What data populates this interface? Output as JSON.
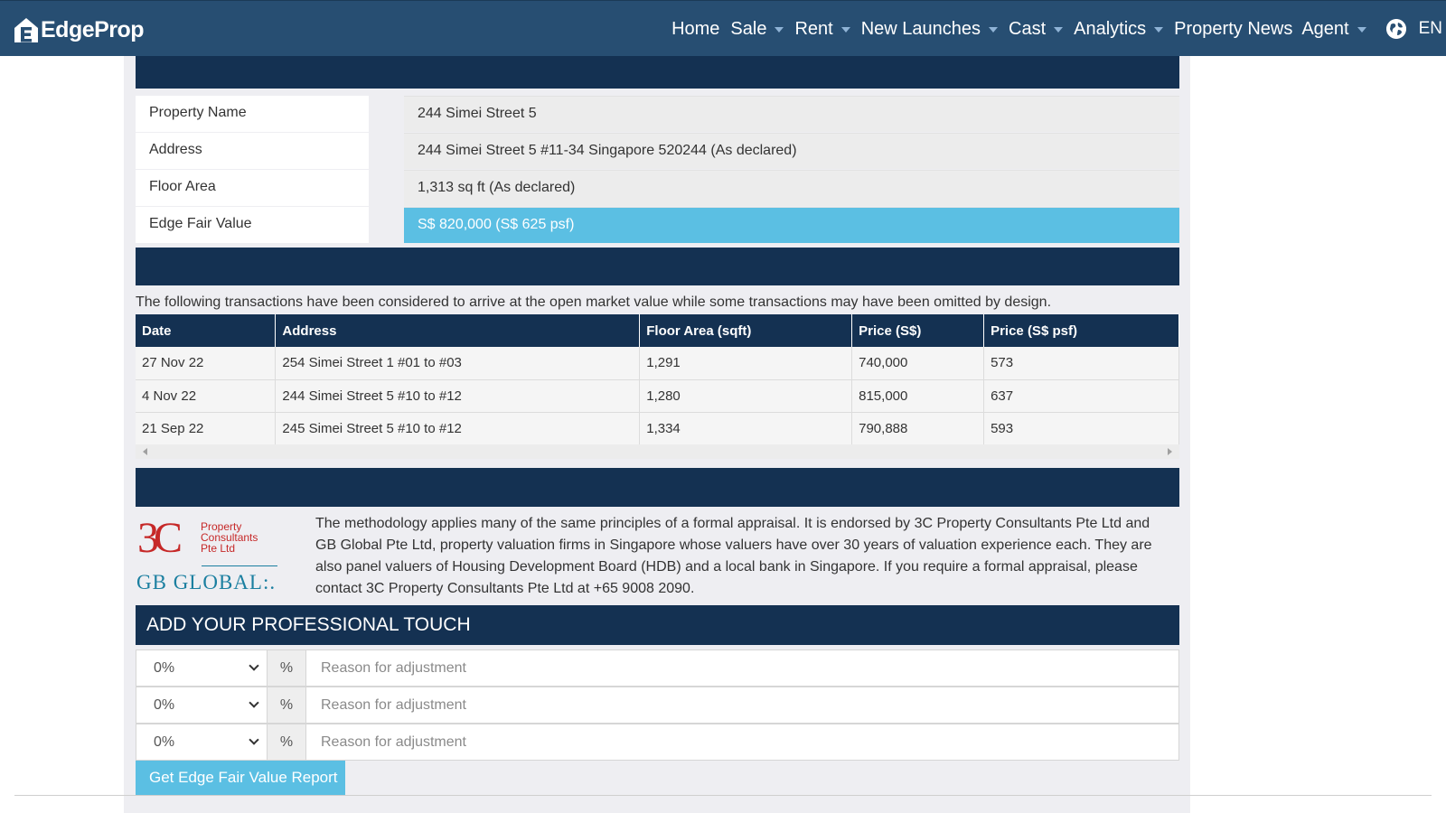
{
  "brand": {
    "name": "EdgeProp",
    "logo_icon": "edgeprop-house-logo-icon",
    "color": "#274e72"
  },
  "nav": {
    "items": [
      {
        "label": "Home",
        "dropdown": false
      },
      {
        "label": "Sale",
        "dropdown": true
      },
      {
        "label": "Rent",
        "dropdown": true
      },
      {
        "label": "New Launches",
        "dropdown": true
      },
      {
        "label": "Cast",
        "dropdown": true
      },
      {
        "label": "Analytics",
        "dropdown": true
      },
      {
        "label": "Property News",
        "dropdown": false
      },
      {
        "label": "Agent",
        "dropdown": true
      }
    ],
    "language_icon": "globe-icon",
    "language": "EN"
  },
  "property": {
    "rows": [
      {
        "label": "Property Name",
        "value": "244 Simei Street 5"
      },
      {
        "label": "Address",
        "value": "244 Simei Street 5 #11-34 Singapore 520244 (As declared)"
      },
      {
        "label": "Floor Area",
        "value": "1,313 sq ft (As declared)"
      },
      {
        "label": "Edge Fair Value",
        "value": "S$ 820,000 (S$ 625 psf)"
      }
    ],
    "highlight_color": "#5bbfe3"
  },
  "transactions": {
    "intro": "The following transactions have been considered to arrive at the open market value while some transactions may have been omitted by design.",
    "headers": [
      "Date",
      "Address",
      "Floor Area (sqft)",
      "Price (S$)",
      "Price (S$ psf)"
    ],
    "rows": [
      [
        "27 Nov 22",
        "254 Simei Street 1 #01 to #03",
        "1,291",
        "740,000",
        "573"
      ],
      [
        "4 Nov 22",
        "244 Simei Street 5 #10 to #12",
        "1,280",
        "815,000",
        "637"
      ],
      [
        "21 Sep 22",
        "245 Simei Street 5 #10 to #12",
        "1,334",
        "790,888",
        "593"
      ]
    ]
  },
  "methodology": {
    "logo_3c": "3C",
    "logo_3c_text": [
      "Property",
      "Consultants",
      "Pte Ltd"
    ],
    "logo_gb": "GB GLOBAL:.",
    "text": "The methodology applies many of the same principles of a formal appraisal. It is endorsed by 3C Property Consultants Pte Ltd and GB Global Pte Ltd, property valuation firms in Singapore whose valuers have over 30 years of valuation experience each. They are also panel valuers of Housing Development Board (HDB) and a local bank in Singapore. If you require a formal appraisal, please contact 3C Property Consultants Pte Ltd at +65 9008 2090."
  },
  "adjustments": {
    "title": "ADD YOUR PROFESSIONAL TOUCH",
    "rows": [
      {
        "selected": "0%",
        "unit": "%",
        "placeholder": "Reason for adjustment"
      },
      {
        "selected": "0%",
        "unit": "%",
        "placeholder": "Reason for adjustment"
      },
      {
        "selected": "0%",
        "unit": "%",
        "placeholder": "Reason for adjustment"
      }
    ],
    "button": "Get Edge Fair Value Report"
  },
  "colors": {
    "dark_navy": "#143152",
    "accent": "#5bbfe3",
    "panel": "#eeeef2"
  }
}
